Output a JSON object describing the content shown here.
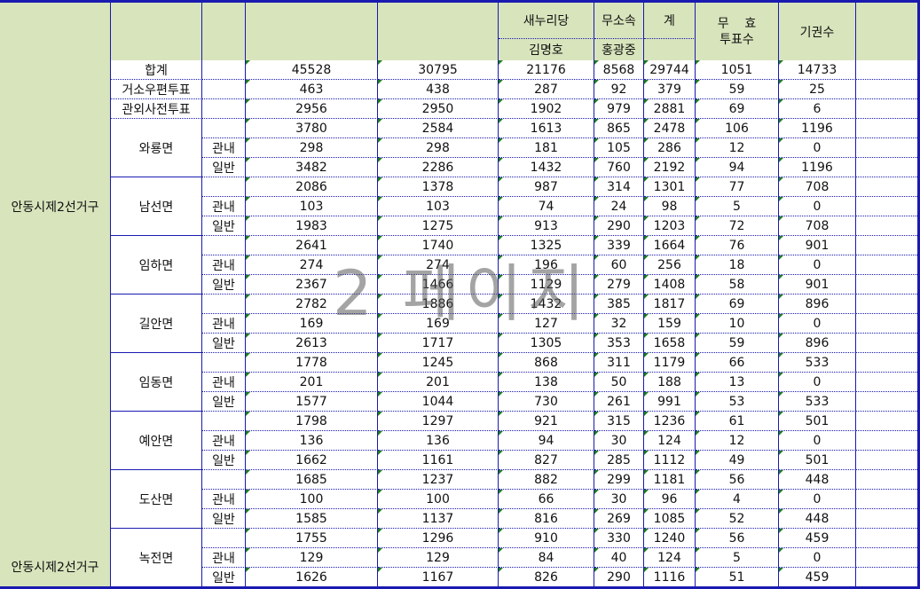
{
  "header": {
    "party1": "새누리당",
    "cand1": "김명호",
    "party2": "무소속",
    "cand2": "홍광중",
    "total": "계",
    "invalid": [
      "무    효",
      "투표수"
    ],
    "abstain": "기권수"
  },
  "district": "안동시제2선거구",
  "summary_rows": [
    {
      "label": "합계",
      "values": [
        "45528",
        "30795",
        "21176",
        "8568",
        "29744",
        "1051",
        "14733"
      ]
    },
    {
      "label": "거소우편투표",
      "values": [
        "463",
        "438",
        "287",
        "92",
        "379",
        "59",
        "25"
      ]
    },
    {
      "label": "관외사전투표",
      "values": [
        "2956",
        "2950",
        "1902",
        "979",
        "2881",
        "69",
        "6"
      ]
    }
  ],
  "towns": [
    {
      "name": "와룡면",
      "rows": [
        {
          "sub": "",
          "values": [
            "3780",
            "2584",
            "1613",
            "865",
            "2478",
            "106",
            "1196"
          ]
        },
        {
          "sub": "관내",
          "values": [
            "298",
            "298",
            "181",
            "105",
            "286",
            "12",
            "0"
          ]
        },
        {
          "sub": "일반",
          "values": [
            "3482",
            "2286",
            "1432",
            "760",
            "2192",
            "94",
            "1196"
          ]
        }
      ]
    },
    {
      "name": "남선면",
      "rows": [
        {
          "sub": "",
          "values": [
            "2086",
            "1378",
            "987",
            "314",
            "1301",
            "77",
            "708"
          ]
        },
        {
          "sub": "관내",
          "values": [
            "103",
            "103",
            "74",
            "24",
            "98",
            "5",
            "0"
          ]
        },
        {
          "sub": "일반",
          "values": [
            "1983",
            "1275",
            "913",
            "290",
            "1203",
            "72",
            "708"
          ]
        }
      ]
    },
    {
      "name": "임하면",
      "rows": [
        {
          "sub": "",
          "values": [
            "2641",
            "1740",
            "1325",
            "339",
            "1664",
            "76",
            "901"
          ]
        },
        {
          "sub": "관내",
          "values": [
            "274",
            "274",
            "196",
            "60",
            "256",
            "18",
            "0"
          ]
        },
        {
          "sub": "일반",
          "values": [
            "2367",
            "1466",
            "1129",
            "279",
            "1408",
            "58",
            "901"
          ]
        }
      ]
    },
    {
      "name": "길안면",
      "rows": [
        {
          "sub": "",
          "values": [
            "2782",
            "1886",
            "1432",
            "385",
            "1817",
            "69",
            "896"
          ]
        },
        {
          "sub": "관내",
          "values": [
            "169",
            "169",
            "127",
            "32",
            "159",
            "10",
            "0"
          ]
        },
        {
          "sub": "일반",
          "values": [
            "2613",
            "1717",
            "1305",
            "353",
            "1658",
            "59",
            "896"
          ]
        }
      ]
    },
    {
      "name": "임동면",
      "rows": [
        {
          "sub": "",
          "values": [
            "1778",
            "1245",
            "868",
            "311",
            "1179",
            "66",
            "533"
          ]
        },
        {
          "sub": "관내",
          "values": [
            "201",
            "201",
            "138",
            "50",
            "188",
            "13",
            "0"
          ]
        },
        {
          "sub": "일반",
          "values": [
            "1577",
            "1044",
            "730",
            "261",
            "991",
            "53",
            "533"
          ]
        }
      ]
    },
    {
      "name": "예안면",
      "rows": [
        {
          "sub": "",
          "values": [
            "1798",
            "1297",
            "921",
            "315",
            "1236",
            "61",
            "501"
          ]
        },
        {
          "sub": "관내",
          "values": [
            "136",
            "136",
            "94",
            "30",
            "124",
            "12",
            "0"
          ]
        },
        {
          "sub": "일반",
          "values": [
            "1662",
            "1161",
            "827",
            "285",
            "1112",
            "49",
            "501"
          ]
        }
      ]
    },
    {
      "name": "도산면",
      "rows": [
        {
          "sub": "",
          "values": [
            "1685",
            "1237",
            "882",
            "299",
            "1181",
            "56",
            "448"
          ]
        },
        {
          "sub": "관내",
          "values": [
            "100",
            "100",
            "66",
            "30",
            "96",
            "4",
            "0"
          ]
        },
        {
          "sub": "일반",
          "values": [
            "1585",
            "1137",
            "816",
            "269",
            "1085",
            "52",
            "448"
          ]
        }
      ]
    },
    {
      "name": "녹전면",
      "rows": [
        {
          "sub": "",
          "values": [
            "1755",
            "1296",
            "910",
            "330",
            "1240",
            "56",
            "459"
          ]
        },
        {
          "sub": "관내",
          "values": [
            "129",
            "129",
            "84",
            "40",
            "124",
            "5",
            "0"
          ]
        },
        {
          "sub": "일반",
          "values": [
            "1626",
            "1167",
            "826",
            "290",
            "1116",
            "51",
            "459"
          ]
        }
      ]
    }
  ],
  "watermark": "2 페이지",
  "colors": {
    "header_bg": "#d8e4bc",
    "grid": "#1a1ab0",
    "frame": "#1a1ab0",
    "corner_mark": "#1e7b1e"
  }
}
